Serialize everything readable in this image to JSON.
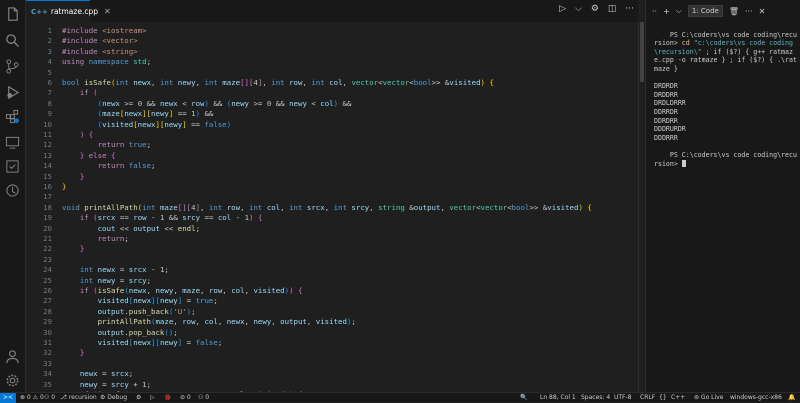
{
  "tab": {
    "icon": "C++",
    "filename": "ratmaze.cpp"
  },
  "activity_bar": [
    "files-icon",
    "search-icon",
    "source-control-icon",
    "run-debug-icon",
    "extensions-icon",
    "remote-explorer-icon",
    "testing-icon",
    "copilot-icon",
    "account-icon",
    "settings-icon"
  ],
  "code_lines": [
    {
      "n": "1",
      "html": "<span class='kc'>#include</span> <span class='s'>&lt;iostream&gt;</span>"
    },
    {
      "n": "2",
      "html": "<span class='kc'>#include</span> <span class='s'>&lt;vector&gt;</span>"
    },
    {
      "n": "3",
      "html": "<span class='kc'>#include</span> <span class='s'>&lt;string&gt;</span>"
    },
    {
      "n": "4",
      "html": "<span class='kc'>using</span> <span class='k'>namespace</span> <span class='t'>std</span>;"
    },
    {
      "n": "5",
      "html": ""
    },
    {
      "n": "6",
      "html": "<span class='k'>bool</span> <span class='f'>isSafe</span><span class='b1'>(</span><span class='k'>int</span> <span class='v'>newx</span>, <span class='k'>int</span> <span class='v'>newy</span>, <span class='k'>int</span> <span class='v'>maze</span><span class='b2'>[]</span><span class='b2'>[</span><span class='n'>4</span><span class='b2'>]</span>, <span class='k'>int</span> <span class='v'>row</span>, <span class='k'>int</span> <span class='v'>col</span>, <span class='t'>vector</span>&lt;<span class='t'>vector</span>&lt;<span class='k'>bool</span>&gt;&gt; &amp;<span class='v'>visited</span><span class='b1'>)</span> <span class='b1'>{</span>"
    },
    {
      "n": "7",
      "html": "    <span class='kc'>if</span> <span class='b2'>(</span>"
    },
    {
      "n": "8",
      "html": "        <span class='b3'>(</span><span class='v'>newx</span> &gt;= <span class='n'>0</span> &amp;&amp; <span class='v'>newx</span> &lt; <span class='v'>row</span><span class='b3'>)</span> &amp;&amp; <span class='b3'>(</span><span class='v'>newy</span> &gt;= <span class='n'>0</span> &amp;&amp; <span class='v'>newy</span> &lt; <span class='v'>col</span><span class='b3'>)</span> &amp;&amp;"
    },
    {
      "n": "9",
      "html": "        <span class='b3'>(</span><span class='v'>maze</span><span class='b1'>[</span><span class='v'>newx</span><span class='b1'>]</span><span class='b1'>[</span><span class='v'>newy</span><span class='b1'>]</span> == <span class='n'>1</span><span class='b3'>)</span> &amp;&amp;"
    },
    {
      "n": "10",
      "html": "        <span class='b3'>(</span><span class='v'>visited</span><span class='b1'>[</span><span class='v'>newx</span><span class='b1'>]</span><span class='b1'>[</span><span class='v'>newy</span><span class='b1'>]</span> == <span class='k'>false</span><span class='b3'>)</span>"
    },
    {
      "n": "11",
      "html": "    <span class='b2'>)</span> <span class='b2'>{</span>"
    },
    {
      "n": "12",
      "html": "        <span class='kc'>return</span> <span class='k'>true</span>;"
    },
    {
      "n": "13",
      "html": "    <span class='b2'>}</span> <span class='kc'>else</span> <span class='b2'>{</span>"
    },
    {
      "n": "14",
      "html": "        <span class='kc'>return</span> <span class='k'>false</span>;"
    },
    {
      "n": "15",
      "html": "    <span class='b2'>}</span>"
    },
    {
      "n": "16",
      "html": "<span class='b1'>}</span>"
    },
    {
      "n": "17",
      "html": ""
    },
    {
      "n": "18",
      "html": "<span class='k'>void</span> <span class='f'>printAllPath</span><span class='b1'>(</span><span class='k'>int</span> <span class='v'>maze</span><span class='b2'>[]</span><span class='b2'>[</span><span class='n'>4</span><span class='b2'>]</span>, <span class='k'>int</span> <span class='v'>row</span>, <span class='k'>int</span> <span class='v'>col</span>, <span class='k'>int</span> <span class='v'>srcx</span>, <span class='k'>int</span> <span class='v'>srcy</span>, <span class='t'>string</span> &amp;<span class='v'>output</span>, <span class='t'>vector</span>&lt;<span class='t'>vector</span>&lt;<span class='k'>bool</span>&gt;&gt; &amp;<span class='v'>visited</span><span class='b1'>)</span> <span class='b1'>{</span>"
    },
    {
      "n": "19",
      "html": "    <span class='kc'>if</span> <span class='b2'>(</span><span class='v'>srcx</span> == <span class='v'>row</span> - <span class='n'>1</span> &amp;&amp; <span class='v'>srcy</span> == <span class='v'>col</span> - <span class='n'>1</span><span class='b2'>)</span> <span class='b2'>{</span>"
    },
    {
      "n": "20",
      "html": "        <span class='v'>cout</span> &lt;&lt; <span class='v'>output</span> &lt;&lt; <span class='f'>endl</span>;"
    },
    {
      "n": "21",
      "html": "        <span class='kc'>return</span>;"
    },
    {
      "n": "22",
      "html": "    <span class='b2'>}</span>"
    },
    {
      "n": "23",
      "html": ""
    },
    {
      "n": "24",
      "html": "    <span class='k'>int</span> <span class='v'>newx</span> = <span class='v'>srcx</span> - <span class='n'>1</span>;"
    },
    {
      "n": "25",
      "html": "    <span class='k'>int</span> <span class='v'>newy</span> = <span class='v'>srcy</span>;"
    },
    {
      "n": "26",
      "html": "    <span class='kc'>if</span> <span class='b2'>(</span><span class='f'>isSafe</span><span class='b3'>(</span><span class='v'>newx</span>, <span class='v'>newy</span>, <span class='v'>maze</span>, <span class='v'>row</span>, <span class='v'>col</span>, <span class='v'>visited</span><span class='b3'>)</span><span class='b2'>)</span> <span class='b2'>{</span>"
    },
    {
      "n": "27",
      "html": "        <span class='v'>visited</span><span class='b3'>[</span><span class='v'>newx</span><span class='b3'>]</span><span class='b3'>[</span><span class='v'>newy</span><span class='b3'>]</span> = <span class='k'>true</span>;"
    },
    {
      "n": "28",
      "html": "        <span class='v'>output</span>.<span class='f'>push_back</span><span class='b3'>(</span><span class='s'>'U'</span><span class='b3'>)</span>;"
    },
    {
      "n": "29",
      "html": "        <span class='f'>printAllPath</span><span class='b3'>(</span><span class='v'>maze</span>, <span class='v'>row</span>, <span class='v'>col</span>, <span class='v'>newx</span>, <span class='v'>newy</span>, <span class='v'>output</span>, <span class='v'>visited</span><span class='b3'>)</span>;"
    },
    {
      "n": "30",
      "html": "        <span class='v'>output</span>.<span class='f'>pop_back</span><span class='b3'>()</span>;"
    },
    {
      "n": "31",
      "html": "        <span class='v'>visited</span><span class='b3'>[</span><span class='v'>newx</span><span class='b3'>]</span><span class='b3'>[</span><span class='v'>newy</span><span class='b3'>]</span> = <span class='k'>false</span>;"
    },
    {
      "n": "32",
      "html": "    <span class='b2'>}</span>"
    },
    {
      "n": "33",
      "html": ""
    },
    {
      "n": "34",
      "html": "    <span class='v'>newx</span> = <span class='v'>srcx</span>;"
    },
    {
      "n": "35",
      "html": "    <span class='v'>newy</span> = <span class='v'>srcy</span> + <span class='n'>1</span>;"
    },
    {
      "n": "36",
      "html": "    <span class='kc'>if</span> <span class='b2'>(</span><span class='f'>isSafe</span><span class='b3'>(</span><span class='v'>newx</span>, <span class='v'>newy</span>, <span class='v'>maze</span>, <span class='v'>row</span>, <span class='v'>col</span>, <span class='v'>visited</span><span class='b3'>)</span><span class='b2'>)</span> <span class='b2'>{</span>"
    }
  ],
  "panel": {
    "selector": "1: Code",
    "add": "+",
    "split": "⌵",
    "trash": "🗑",
    "more": "···",
    "close": "✕"
  },
  "terminal": {
    "prompt1": "PS C:\\coders\\vs code coding\\recursion> ",
    "cmd_cd": "cd ",
    "cmd_path": "\"c:\\coders\\vs code coding\\recursion\\\"",
    "cmd_rest": " ; if ($?) { g++ ratmaze.cpp -o ratmaze } ; if ($?) { .\\ratmaze }",
    "output": [
      "DRDRDR",
      "DRDDRR",
      "DRDLDRRR",
      "DDRRDR",
      "DDRDRR",
      "DDDRURDR",
      "DDDRRR"
    ],
    "prompt2": "PS C:\\coders\\vs code coding\\recursion> "
  },
  "status": {
    "remote": "><",
    "errors": "⊗ 0 ⚠ 0",
    "ports": "⚇ 0",
    "branch": "⎇ recursion",
    "debug": "⚙ Debug",
    "gear": "⚙",
    "run": "▷",
    "bug": "🐞",
    "info": "⊘ 0",
    "signal": "⚇ 0",
    "position": "Ln 88, Col 1",
    "spaces": "Spaces: 4",
    "encoding": "UTF-8",
    "eol": "CRLF",
    "braces": "{}",
    "language": "C++",
    "golive": "⊚ Go Live",
    "compiler": "windows-gcc-x86"
  }
}
